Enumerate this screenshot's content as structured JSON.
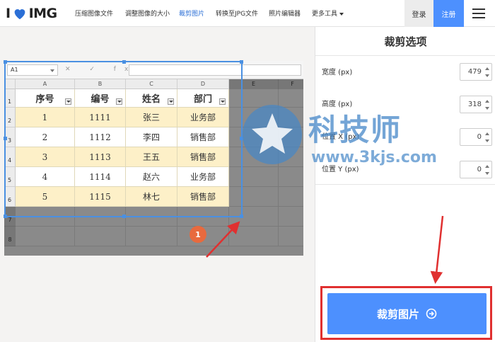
{
  "nav": {
    "logo_left": "I",
    "logo_right": "IMG",
    "items": [
      "压缩图像文件",
      "调整图像的大小",
      "裁剪图片",
      "转换至JPG文件",
      "照片编辑器",
      "更多工具"
    ],
    "login": "登录",
    "register": "注册"
  },
  "sheet": {
    "name_box": "A1",
    "formula_icons": "✕ ✓ fx",
    "columns": [
      "A",
      "B",
      "C",
      "D",
      "E",
      "F"
    ],
    "rows": [
      "1",
      "2",
      "3",
      "4",
      "5",
      "6",
      "7",
      "8"
    ],
    "headers": [
      "序号",
      "编号",
      "姓名",
      "部门"
    ],
    "data": [
      [
        "1",
        "1111",
        "张三",
        "业务部"
      ],
      [
        "2",
        "1112",
        "李四",
        "销售部"
      ],
      [
        "3",
        "1113",
        "王五",
        "销售部"
      ],
      [
        "4",
        "1114",
        "赵六",
        "业务部"
      ],
      [
        "5",
        "1115",
        "林七",
        "销售部"
      ]
    ]
  },
  "marker": "1",
  "watermark": {
    "title": "科技师",
    "url": "www.3kjs.com"
  },
  "panel": {
    "title": "裁剪选项",
    "fields": [
      {
        "label": "宽度 (px)",
        "value": "479"
      },
      {
        "label": "高度 (px)",
        "value": "318"
      },
      {
        "label": "位置 X (px)",
        "value": "0"
      },
      {
        "label": "位置 Y (px)",
        "value": "0"
      }
    ],
    "button": "裁剪图片"
  },
  "colors": {
    "accent": "#4d90fe",
    "highlight": "#e03030",
    "row_band": "#fdf0c8"
  }
}
